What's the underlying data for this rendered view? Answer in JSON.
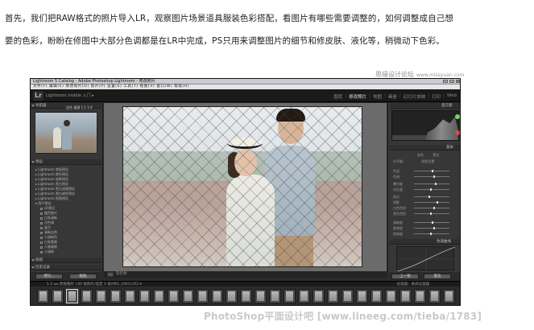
{
  "article": {
    "line1": "首先，我们把RAW格式的照片导入LR，观察图片场景道具服装色彩搭配，看图片有哪些需要调整的，如何调整成自己想",
    "line2": "要的色彩，盼盼在修图中大部分色调都是在LR中完成，PS只用来调整图片的细节和修皮肤、液化等，稍微动下色彩。"
  },
  "site_mark": {
    "name": "思缘设计论坛",
    "url": "www.missyuan.com"
  },
  "lightroom": {
    "window_title": "Lightroom 5 Catalog - Adobe Photoshop Lightroom - 修改照片",
    "menu": "文件(F)  编辑(E)  修改照片(D)  照片(P)  设置(S)  工具(T)  视图(V)  窗口(W)  帮助(H)",
    "logo": "Lr",
    "catalog_name": "Lightroom mobile 入门 ▸",
    "modules": [
      "图库",
      "修改照片",
      "地图",
      "画册",
      "幻灯片放映",
      "打印",
      "Web"
    ],
    "active_module": "修改照片",
    "left_panel": {
      "navigator_label": "导航器",
      "navigator_options": "适合  填满  1:1  1:4",
      "presets_label": "预设",
      "presets": [
        "Lightroom 常规预设",
        "Lightroom 颜色预设",
        "Lightroom 效果预设",
        "Lightroom 黑白预设",
        "Lightroom 黑白滤镜预设",
        "Lightroom 黑白调色预设",
        "Lightroom 视频预设",
        "用户预设"
      ],
      "user_presets": [
        "LR预设",
        "暖色胶片",
        "日系清新",
        "冷色调",
        "复古",
        "清新自然",
        "小清新色",
        "日系素颜",
        "人像美颜",
        "小清新"
      ],
      "snapshots_label": "快照",
      "history_label": "历史记录",
      "buttons": [
        "拷贝...",
        "粘贴"
      ]
    },
    "right_panel": {
      "histogram_label": "直方图",
      "basic_label": "基本",
      "treatment": [
        "彩色",
        "黑白"
      ],
      "white_balance": "白平衡：",
      "wb_value": "原照设置",
      "rows": [
        "色温",
        "色调",
        "曝光度",
        "对比度",
        "高光",
        "阴影",
        "白色色阶",
        "黑色色阶",
        "清晰度",
        "鲜艳度",
        "饱和度"
      ],
      "tone_curve_label": "色调曲线",
      "buttons": [
        "上一张",
        "复位"
      ]
    },
    "toolbar_label": "软打样",
    "filmstrip": {
      "info": "1  2  ◂ ▸  原照相片  |  60 张照片/选定 1 张/IMG_1903.CR2 ▾",
      "filter": "过滤器：关闭过滤器"
    }
  },
  "watermark": "PhotoShop平面设计吧 [www.lineeg.com/tieba/1783]"
}
